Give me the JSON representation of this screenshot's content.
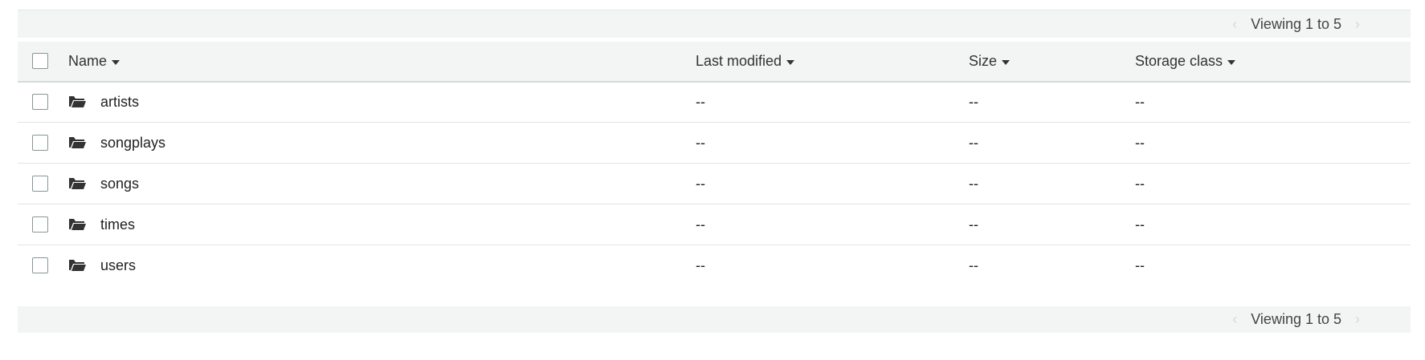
{
  "pager": {
    "prev_icon": "chevron-left-icon",
    "next_icon": "chevron-right-icon",
    "prev_glyph": "‹",
    "next_glyph": "›",
    "label": "Viewing 1 to 5"
  },
  "columns": {
    "name": "Name",
    "last_modified": "Last modified",
    "size": "Size",
    "storage_class": "Storage class"
  },
  "rows": [
    {
      "name": "artists",
      "last_modified": "--",
      "size": "--",
      "storage_class": "--",
      "icon": "folder-open-icon"
    },
    {
      "name": "songplays",
      "last_modified": "--",
      "size": "--",
      "storage_class": "--",
      "icon": "folder-open-icon"
    },
    {
      "name": "songs",
      "last_modified": "--",
      "size": "--",
      "storage_class": "--",
      "icon": "folder-open-icon"
    },
    {
      "name": "times",
      "last_modified": "--",
      "size": "--",
      "storage_class": "--",
      "icon": "folder-open-icon"
    },
    {
      "name": "users",
      "last_modified": "--",
      "size": "--",
      "storage_class": "--",
      "icon": "folder-open-icon"
    }
  ]
}
